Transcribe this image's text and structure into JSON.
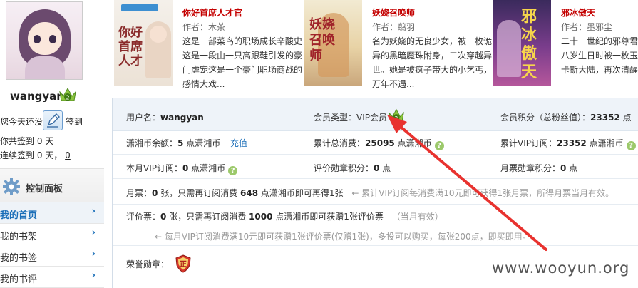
{
  "sidebar": {
    "username": "wangyan",
    "level": "2",
    "checkin_prompt": "您今天还没",
    "checkin_label": "签到",
    "checkin_days_text": "你共签到",
    "checkin_days": "0",
    "checkin_days_unit": "天",
    "streak_text": "连续签到",
    "streak_days": "0",
    "streak_mid": "天，",
    "streak_extra": "0",
    "panel_title": "控制面板",
    "nav": [
      {
        "label": "我的首页",
        "active": true
      },
      {
        "label": "我的书架"
      },
      {
        "label": "我的书签"
      },
      {
        "label": "我的书评"
      }
    ]
  },
  "books": [
    {
      "title": "你好首席人才官",
      "author": "作者：木茶",
      "desc": "这是一部菜鸟的职场成长辛酸史这是一段由一只高跟鞋引发的豪门虐宠这是一个豪门职场商战的感情大戏..."
    },
    {
      "title": "妖娆召唤师",
      "author": "作者：翦羽",
      "desc": "名为妖娆的无良少女，被一枚诡异的黑暗魔珠附身，二次穿越异世。她是被疯子带大的小乞丐，万年不遇..."
    },
    {
      "title": "邪冰傲天",
      "author": "作者：墨邪尘",
      "desc": "二十一世纪的邪尊君八岁生日时被一枚玉卡斯大陆，再次清醒一名婴儿！前世..."
    }
  ],
  "info": {
    "username_label": "用户名：",
    "username": "wangyan",
    "member_type_label": "会员类型：",
    "member_type": "VIP会员",
    "points_label": "会员积分（总粉丝值）：",
    "points": "23352",
    "points_unit": " 点",
    "balance_label": "潇湘币余额：",
    "balance": "5",
    "balance_unit": " 点潇湘币",
    "recharge": "充值",
    "total_spend_label": "累计总消费：",
    "total_spend": "25095",
    "total_spend_unit": " 点潇湘币",
    "total_vip_label": "累计VIP订阅：",
    "total_vip": "23352",
    "total_vip_unit": " 点潇湘币",
    "month_vip_label": "本月VIP订阅：",
    "month_vip": "0",
    "month_vip_unit": " 点潇湘币",
    "review_score_label": "评价勋章积分：",
    "review_score": "0",
    "review_score_unit": " 点",
    "month_ticket_score_label": "月票勋章积分：",
    "month_ticket_score": "0",
    "month_ticket_score_unit": " 点",
    "monthly_ticket_label": "月票：",
    "monthly_ticket_count": "0",
    "monthly_ticket_text1": " 张，只需再订阅消费 ",
    "monthly_ticket_need": "648",
    "monthly_ticket_text2": " 点潇湘币即可再得1张",
    "monthly_ticket_note": "← 累计VIP订阅每消费满10元即可获得1张月票，所得月票当月有效。",
    "review_ticket_label": "评价票：",
    "review_ticket_count": "0",
    "review_ticket_text1": " 张，只需再订阅消费 ",
    "review_ticket_need": "1000",
    "review_ticket_text2": " 点潇湘币即可获赠1张评价票",
    "review_ticket_note": "（当月有效）",
    "review_ticket_rule": "← 每月VIP订阅消费满10元即可获赠1张评价票(仅赠1张)，多投可以购买，每张200点，即买即用。",
    "honor_label": "荣誉勋章：",
    "honor_badge_text": "正"
  },
  "watermark": "www.wooyun.org",
  "colors": {
    "accent_blue": "#1a6eb8",
    "book_title_red": "#c40000",
    "arrow_red": "#e8322f",
    "help_green": "#9cc96b"
  }
}
